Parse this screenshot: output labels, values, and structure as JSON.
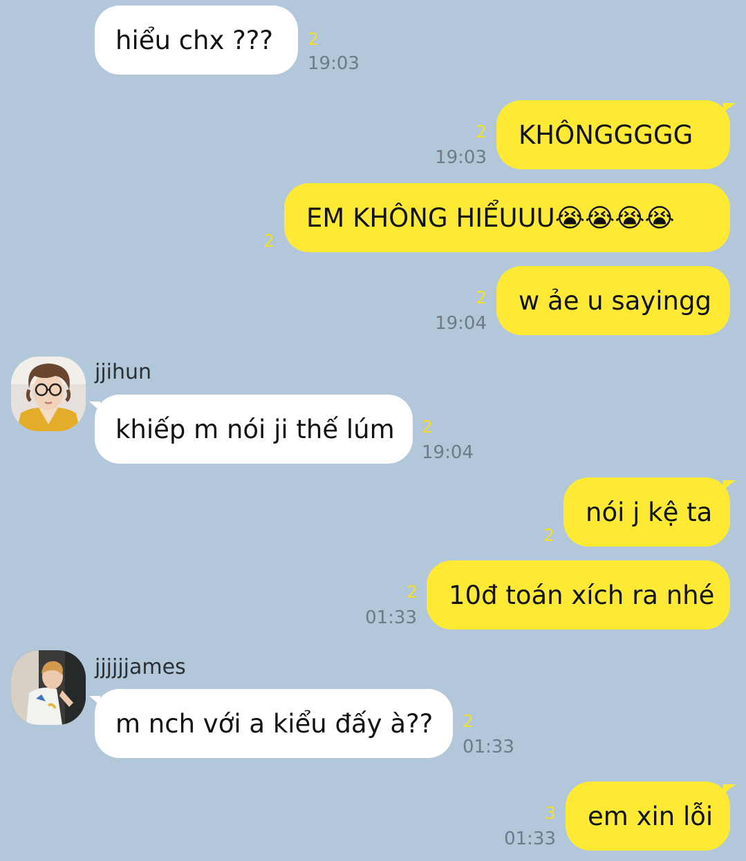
{
  "messages": [
    {
      "text": "hiểu chx ???",
      "count": "2",
      "time": "19:03"
    },
    {
      "text": "KHÔNGGGGG",
      "count": "2",
      "time": "19:03"
    },
    {
      "text": "EM KHÔNG HIỂUUU😭😭😭😭",
      "count": "2"
    },
    {
      "text": "w ảe u sayingg",
      "count": "2",
      "time": "19:04"
    },
    {
      "sender": "jjihun",
      "text": "khiếp m nói ji thế lúm",
      "count": "2",
      "time": "19:04"
    },
    {
      "text": "nói j kệ ta",
      "count": "2"
    },
    {
      "text": "10đ toán xích ra nhé",
      "count": "2",
      "time": "01:33"
    },
    {
      "sender": "jjjjjjames",
      "text": "m nch với a kiểu đấy à??",
      "count": "2",
      "time": "01:33"
    },
    {
      "text": "em xin lỗi",
      "count": "3",
      "time": "01:33"
    }
  ],
  "colors": {
    "background": "#b2c7da",
    "outgoing": "#fee934",
    "incoming": "#ffffff",
    "read_count": "#f3df2a",
    "time": "#6e7a86"
  }
}
